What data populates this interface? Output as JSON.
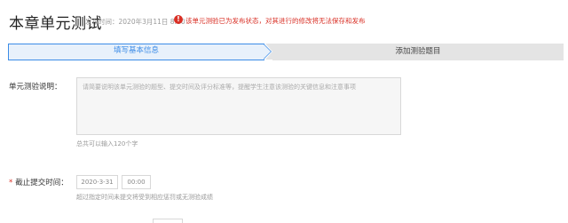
{
  "header": {
    "title": "本章单元测试",
    "publish_time": "发布时间：2020年3月11日 8:00",
    "warning_icon": "!",
    "warning_text": "该单元测验已为发布状态，对其进行的修改将无法保存和发布"
  },
  "steps": [
    {
      "label": "填写基本信息",
      "active": true
    },
    {
      "label": "添加测验题目",
      "active": false
    }
  ],
  "form": {
    "description": {
      "label": "单元测验说明：",
      "placeholder": "请简要说明该单元测验的题型、提交时间及评分标准等，提醒学生注意该测验的关键信息和注意事项",
      "hint": "总共可以输入120个字"
    },
    "deadline": {
      "required_mark": "*",
      "label": "截止提交时间：",
      "date": "2020-3-31",
      "time": "00:00",
      "hint": "超过指定时间未提交将受到相应惩罚或无测验成绩"
    }
  },
  "colors": {
    "accent": "#3c8ce7",
    "warning": "#d93026",
    "step_active_bg": "#e8f1fb",
    "step_inactive_bg": "#e4e4e4"
  }
}
